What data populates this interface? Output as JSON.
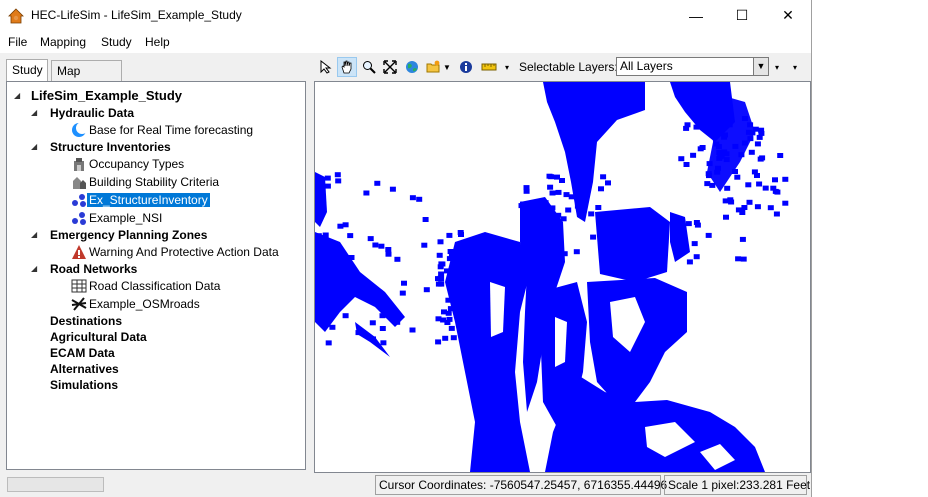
{
  "window": {
    "title": "HEC-LifeSim - LifeSim_Example_Study"
  },
  "menu": [
    "File",
    "Mapping",
    "Study",
    "Help"
  ],
  "tabs": [
    {
      "label": "Study",
      "active": true
    },
    {
      "label": "Map Layers",
      "active": false
    }
  ],
  "tree": {
    "root": "LifeSim_Example_Study",
    "groups": [
      {
        "label": "Hydraulic Data",
        "children": [
          {
            "label": "Base for Real Time forecasting",
            "icon": "hydraulic-moon-icon"
          }
        ]
      },
      {
        "label": "Structure Inventories",
        "children": [
          {
            "label": "Occupancy Types",
            "icon": "occupancy-icon"
          },
          {
            "label": "Building Stability Criteria",
            "icon": "stability-icon"
          },
          {
            "label": "Ex_StructureInventory",
            "icon": "structure-inventory-icon",
            "selected": true
          },
          {
            "label": "Example_NSI",
            "icon": "nsi-icon"
          }
        ]
      },
      {
        "label": "Emergency Planning Zones",
        "children": [
          {
            "label": "Warning And Protective Action Data",
            "icon": "warning-icon"
          }
        ]
      },
      {
        "label": "Road Networks",
        "children": [
          {
            "label": "Road Classification Data",
            "icon": "table-icon"
          },
          {
            "label": "Example_OSMroads",
            "icon": "roads-icon"
          }
        ]
      }
    ],
    "leaves": [
      "Destinations",
      "Agricultural Data",
      "ECAM Data",
      "Alternatives",
      "Simulations"
    ]
  },
  "toolbar": {
    "selectable_label": "Selectable Layers:",
    "selectable_value": "All Layers"
  },
  "status": {
    "cursor": "Cursor Coordinates: -7560547.25457, 6716355.44496",
    "scale": "Scale 1 pixel:233.281 Feet"
  },
  "colors": {
    "structures": "#0000ff",
    "selection": "#0078d7"
  }
}
